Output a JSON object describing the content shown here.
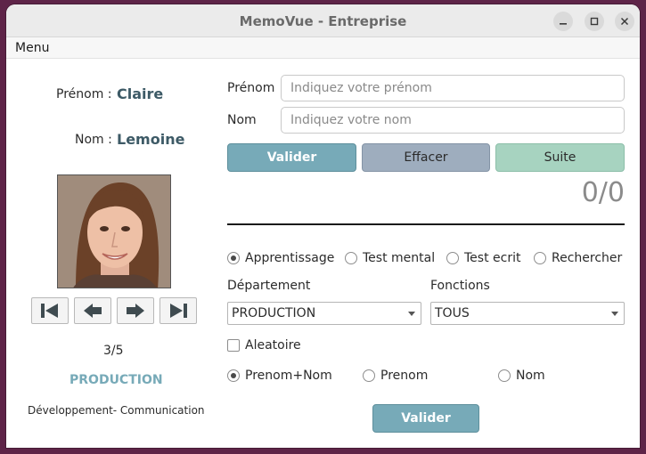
{
  "window": {
    "title": "MemoVue - Entreprise"
  },
  "menu": {
    "label": "Menu"
  },
  "person": {
    "firstname_label": "Prénom :",
    "firstname": "Claire",
    "lastname_label": "Nom :",
    "lastname": "Lemoine",
    "position": "3/5",
    "department": "PRODUCTION",
    "functions": "Développement- Communication"
  },
  "form": {
    "firstname_label": "Prénom",
    "firstname_placeholder": "Indiquez votre prénom",
    "lastname_label": "Nom",
    "lastname_placeholder": "Indiquez votre nom",
    "validate": "Valider",
    "clear": "Effacer",
    "next": "Suite",
    "score": "0/0"
  },
  "modes": {
    "options": [
      "Apprentissage",
      "Test mental",
      "Test ecrit",
      "Rechercher"
    ],
    "selected": "Apprentissage"
  },
  "filters": {
    "department_label": "Département",
    "department_value": "PRODUCTION",
    "functions_label": "Fonctions",
    "functions_value": "TOUS",
    "random_label": "Aleatoire",
    "random_checked": false
  },
  "display": {
    "options": [
      "Prenom+Nom",
      "Prenom",
      "Nom"
    ],
    "selected": "Prenom+Nom"
  },
  "bottom": {
    "validate": "Valider"
  },
  "colors": {
    "validate_bg": "#77aab8",
    "clear_bg": "#9eadbe",
    "next_bg": "#a7d3c0",
    "department_text": "#77aab8"
  },
  "icons": {
    "nav": [
      "first-icon",
      "previous-icon",
      "next-icon",
      "last-icon"
    ],
    "window": [
      "minimize-icon",
      "maximize-icon",
      "close-icon"
    ]
  }
}
